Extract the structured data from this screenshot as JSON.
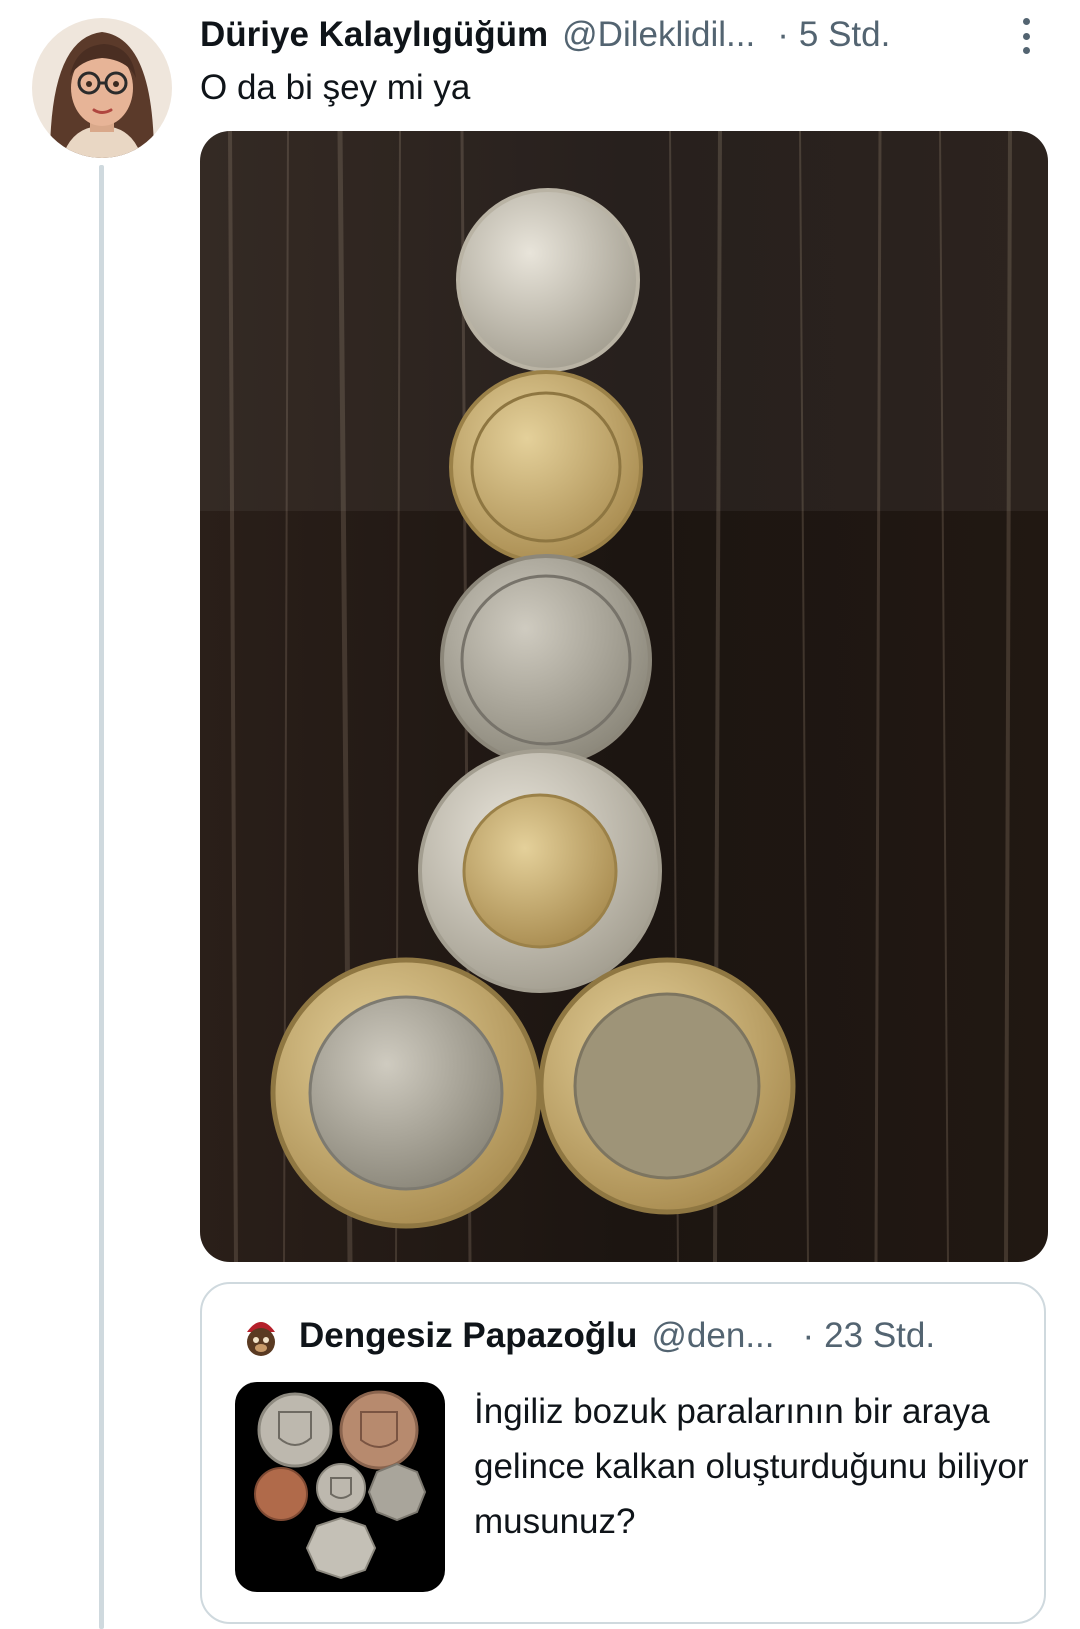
{
  "tweet": {
    "display_name": "Düriye Kalaylıgüğüm",
    "handle": "@Dileklidil...",
    "separator": "·",
    "time": "5 Std.",
    "text": "O da bi şey mi ya",
    "more_icon": "more-vertical-icon"
  },
  "quoted_tweet": {
    "display_name": "Dengesiz Papazoğlu",
    "handle": "@den...",
    "separator": "·",
    "time": "23 Std.",
    "text": "İngiliz bozuk paralarının bir araya gelince kalkan oluşturduğunu biliyor musunuz?"
  },
  "colors": {
    "text_primary": "#0f1419",
    "text_secondary": "#536471",
    "border": "#cfd9de"
  }
}
